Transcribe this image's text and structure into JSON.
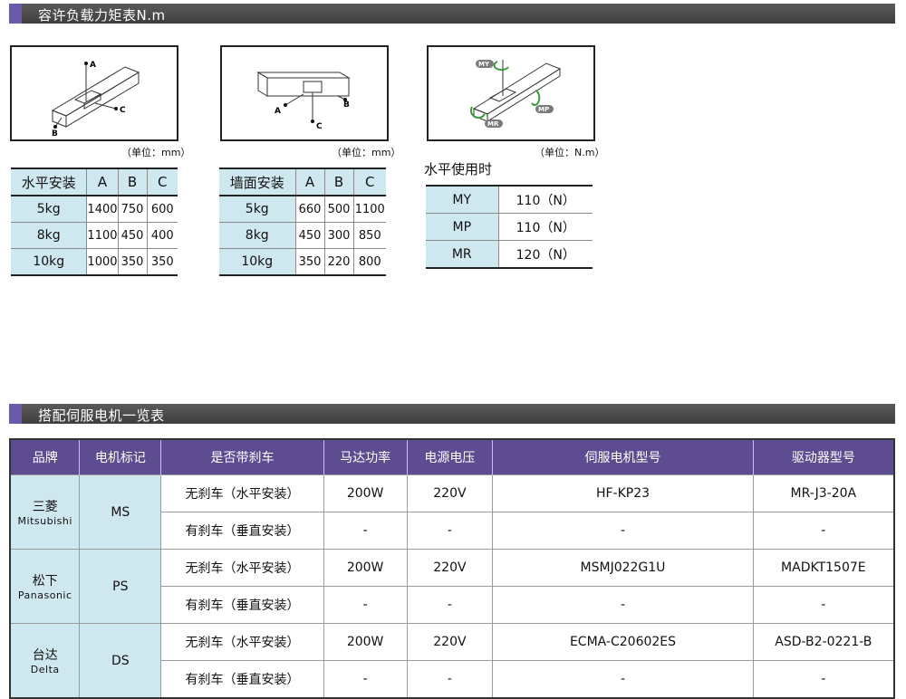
{
  "section1": {
    "title": "容许负载力矩表N.m"
  },
  "diagrams": {
    "horizontal": {
      "labels": [
        "A",
        "B",
        "C"
      ],
      "unit": "（单位：mm）"
    },
    "wall": {
      "labels": [
        "A",
        "B",
        "C"
      ],
      "unit": "（单位：mm）"
    },
    "moment": {
      "labels": [
        "MY",
        "MP",
        "MR"
      ],
      "unit": "（单位：N.m）"
    }
  },
  "table_horizontal": {
    "headers": [
      "水平安装",
      "A",
      "B",
      "C"
    ],
    "rows": [
      [
        "5kg",
        "1400",
        "750",
        "600"
      ],
      [
        "8kg",
        "1100",
        "450",
        "400"
      ],
      [
        "10kg",
        "1000",
        "350",
        "350"
      ]
    ]
  },
  "table_wall": {
    "headers": [
      "墙面安装",
      "A",
      "B",
      "C"
    ],
    "rows": [
      [
        "5kg",
        "660",
        "500",
        "1100"
      ],
      [
        "8kg",
        "450",
        "300",
        "850"
      ],
      [
        "10kg",
        "350",
        "220",
        "800"
      ]
    ]
  },
  "table_moment": {
    "title": "水平使用时",
    "rows": [
      [
        "MY",
        "110（N）"
      ],
      [
        "MP",
        "110（N）"
      ],
      [
        "MR",
        "120（N）"
      ]
    ]
  },
  "section2": {
    "title": "搭配伺服电机一览表"
  },
  "motor_table": {
    "headers": [
      "品牌",
      "电机标记",
      "是否带刹车",
      "马达功率",
      "电源电压",
      "伺服电机型号",
      "驱动器型号"
    ],
    "brands": [
      {
        "zh": "三菱",
        "en": "Mitsubishi",
        "mark": "MS",
        "rows": [
          [
            "无刹车（水平安装）",
            "200W",
            "220V",
            "HF-KP23",
            "MR-J3-20A"
          ],
          [
            "有刹车（垂直安装）",
            "-",
            "-",
            "-",
            "-"
          ]
        ]
      },
      {
        "zh": "松下",
        "en": "Panasonic",
        "mark": "PS",
        "rows": [
          [
            "无刹车（水平安装）",
            "200W",
            "220V",
            "MSMJ022G1U",
            "MADKT1507E"
          ],
          [
            "有刹车（垂直安装）",
            "-",
            "-",
            "-",
            "-"
          ]
        ]
      },
      {
        "zh": "台达",
        "en": "Delta",
        "mark": "DS",
        "rows": [
          [
            "无刹车（水平安装）",
            "200W",
            "220V",
            "ECMA-C20602ES",
            "ASD-B2-0221-B"
          ],
          [
            "有刹车（垂直安装）",
            "-",
            "-",
            "-",
            "-"
          ]
        ]
      }
    ]
  },
  "colors": {
    "header_bar": "#4a4a4a",
    "accent": "#6a5aa8",
    "cell_blue": "#cfe7ef",
    "table_head": "#5d4c8f"
  }
}
